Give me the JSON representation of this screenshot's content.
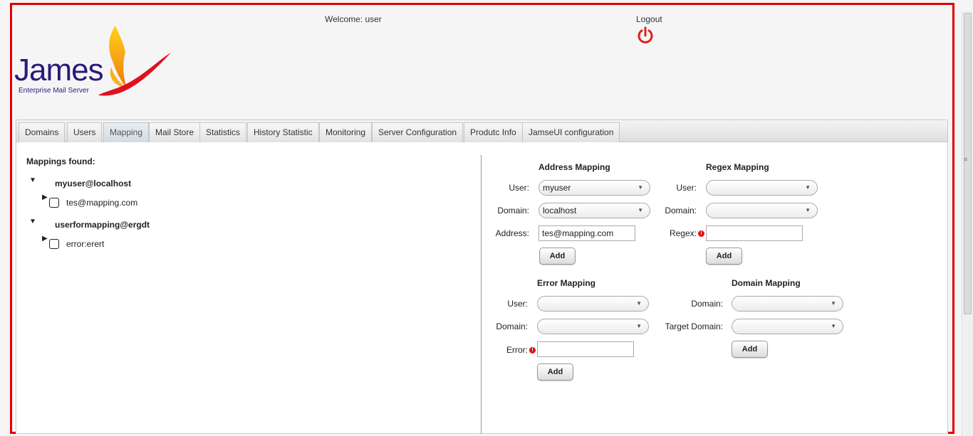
{
  "header": {
    "logo_name": "James",
    "logo_tagline": "Enterprise Mail Server",
    "welcome": "Welcome: user",
    "logout_label": "Logout"
  },
  "tabs": [
    {
      "label": "Domains"
    },
    {
      "label": "Users"
    },
    {
      "label": "Mapping"
    },
    {
      "label": "Mail Store"
    },
    {
      "label": "Statistics"
    },
    {
      "label": "History Statistic"
    },
    {
      "label": "Monitoring"
    },
    {
      "label": "Server Configuration"
    },
    {
      "label": "Produtc Info"
    },
    {
      "label": "JamseUI configuration"
    }
  ],
  "active_tab": "Mapping",
  "mappings": {
    "title": "Mappings found:",
    "groups": [
      {
        "user": "myuser@localhost",
        "items": [
          "tes@mapping.com"
        ]
      },
      {
        "user": "userformapping@ergdt",
        "items": [
          "error:erert"
        ]
      }
    ]
  },
  "address_mapping": {
    "title": "Address Mapping",
    "user_label": "User:",
    "user_value": "myuser",
    "domain_label": "Domain:",
    "domain_value": "localhost",
    "address_label": "Address:",
    "address_value": "tes@mapping.com",
    "add_label": "Add"
  },
  "regex_mapping": {
    "title": "Regex Mapping",
    "user_label": "User:",
    "domain_label": "Domain:",
    "regex_label": "Regex:",
    "add_label": "Add"
  },
  "error_mapping": {
    "title": "Error Mapping",
    "user_label": "User:",
    "domain_label": "Domain:",
    "error_label": "Error:",
    "add_label": "Add"
  },
  "domain_mapping": {
    "title": "Domain Mapping",
    "domain_label": "Domain:",
    "target_label": "Target Domain:",
    "add_label": "Add"
  },
  "colors": {
    "frame": "#e00000",
    "logo_text": "#2a1a7a",
    "power_icon": "#e02020",
    "required_icon": "#d11111"
  }
}
